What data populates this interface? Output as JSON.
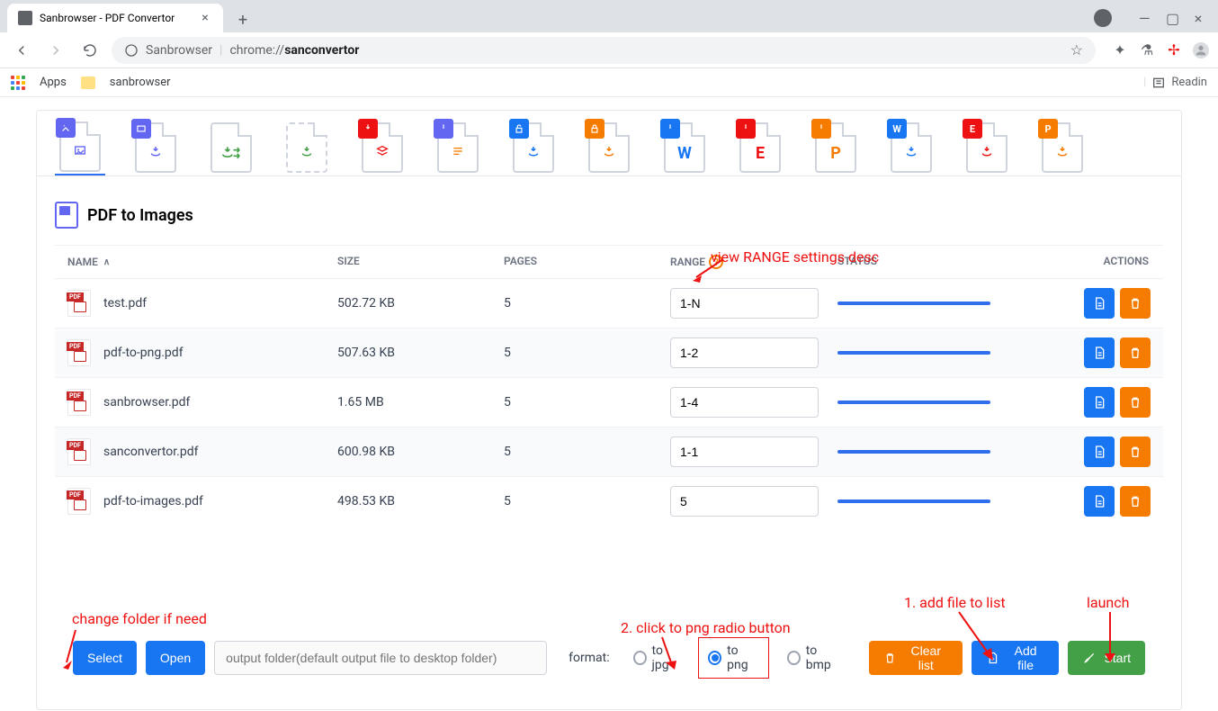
{
  "browser": {
    "tab_title": "Sanbrowser - PDF Convertor",
    "omnibox_prefix": "Sanbrowser",
    "omnibox_url": "chrome://sanconvertor",
    "apps_label": "Apps",
    "bookmark_1": "sanbrowser",
    "reading_list": "Readin"
  },
  "section_title": "PDF to Images",
  "columns": {
    "name": "NAME",
    "size": "SIZE",
    "pages": "PAGES",
    "range": "RANGE",
    "status": "STATUS",
    "actions": "ACTIONS"
  },
  "rows": [
    {
      "name": "test.pdf",
      "size": "502.72 KB",
      "pages": "5",
      "range": "1-N"
    },
    {
      "name": "pdf-to-png.pdf",
      "size": "507.63 KB",
      "pages": "5",
      "range": "1-2"
    },
    {
      "name": "sanbrowser.pdf",
      "size": "1.65 MB",
      "pages": "5",
      "range": "1-4"
    },
    {
      "name": "sanconvertor.pdf",
      "size": "600.98 KB",
      "pages": "5",
      "range": "1-1"
    },
    {
      "name": "pdf-to-images.pdf",
      "size": "498.53 KB",
      "pages": "5",
      "range": "5"
    }
  ],
  "footer": {
    "select": "Select",
    "open": "Open",
    "folder_placeholder": "output folder(default output file to desktop folder)",
    "format_label": "format:",
    "jpg": "to jpg",
    "png": "to png",
    "bmp": "to bmp",
    "clear": "Clear list",
    "add": "Add file",
    "start": "Start"
  },
  "annotations": {
    "range_desc": "view RANGE settings desc",
    "folder": "change folder if need",
    "png": "2. click to png radio button",
    "addfile": "1. add file to list",
    "launch": "launch"
  }
}
